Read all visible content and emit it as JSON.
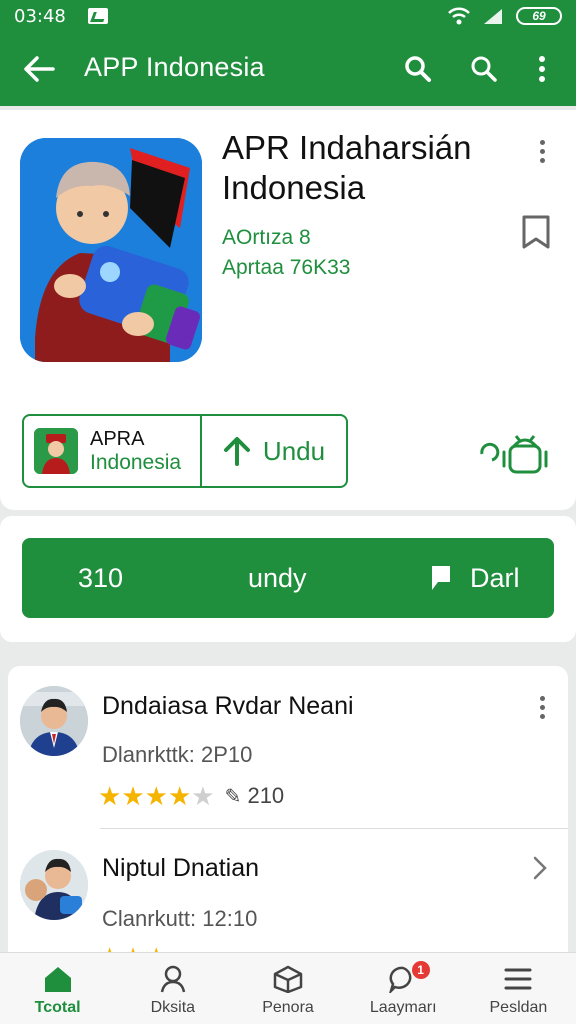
{
  "status_bar": {
    "time": "03:48",
    "battery": "69"
  },
  "app_bar": {
    "title": "APP Indonesia"
  },
  "app": {
    "name": "APR Indaharsián Indonesia",
    "meta_line_1": "AOrtıza 8",
    "meta_line_2": "Aprtaa 76K33"
  },
  "developer": {
    "line_1": "APRA",
    "line_2": "Indonesia"
  },
  "download_button": {
    "label": "Undu"
  },
  "install_bar": {
    "count": "310",
    "label": "undy",
    "action": "Darl"
  },
  "reviews": [
    {
      "name": "Dndaiasa Rvdar Neani",
      "date": "Dlanrkttk: 2P10",
      "rating": 4,
      "count": "210"
    },
    {
      "name": "Niptul Dnatian",
      "date": "Clanrkutt: 12:10",
      "rating": 3,
      "count": ""
    }
  ],
  "bottom_nav": [
    {
      "label": "Tcotal",
      "icon": "home-icon",
      "active": true
    },
    {
      "label": "Dksita",
      "icon": "person-icon",
      "active": false
    },
    {
      "label": "Penora",
      "icon": "box-icon",
      "active": false
    },
    {
      "label": "Laaymarı",
      "icon": "chat-icon",
      "active": false,
      "badge": "1"
    },
    {
      "label": "Pesldan",
      "icon": "menu-icon",
      "active": false
    }
  ],
  "colors": {
    "brand": "#1f8f3e",
    "star": "#f4b400",
    "badge": "#e53935"
  }
}
